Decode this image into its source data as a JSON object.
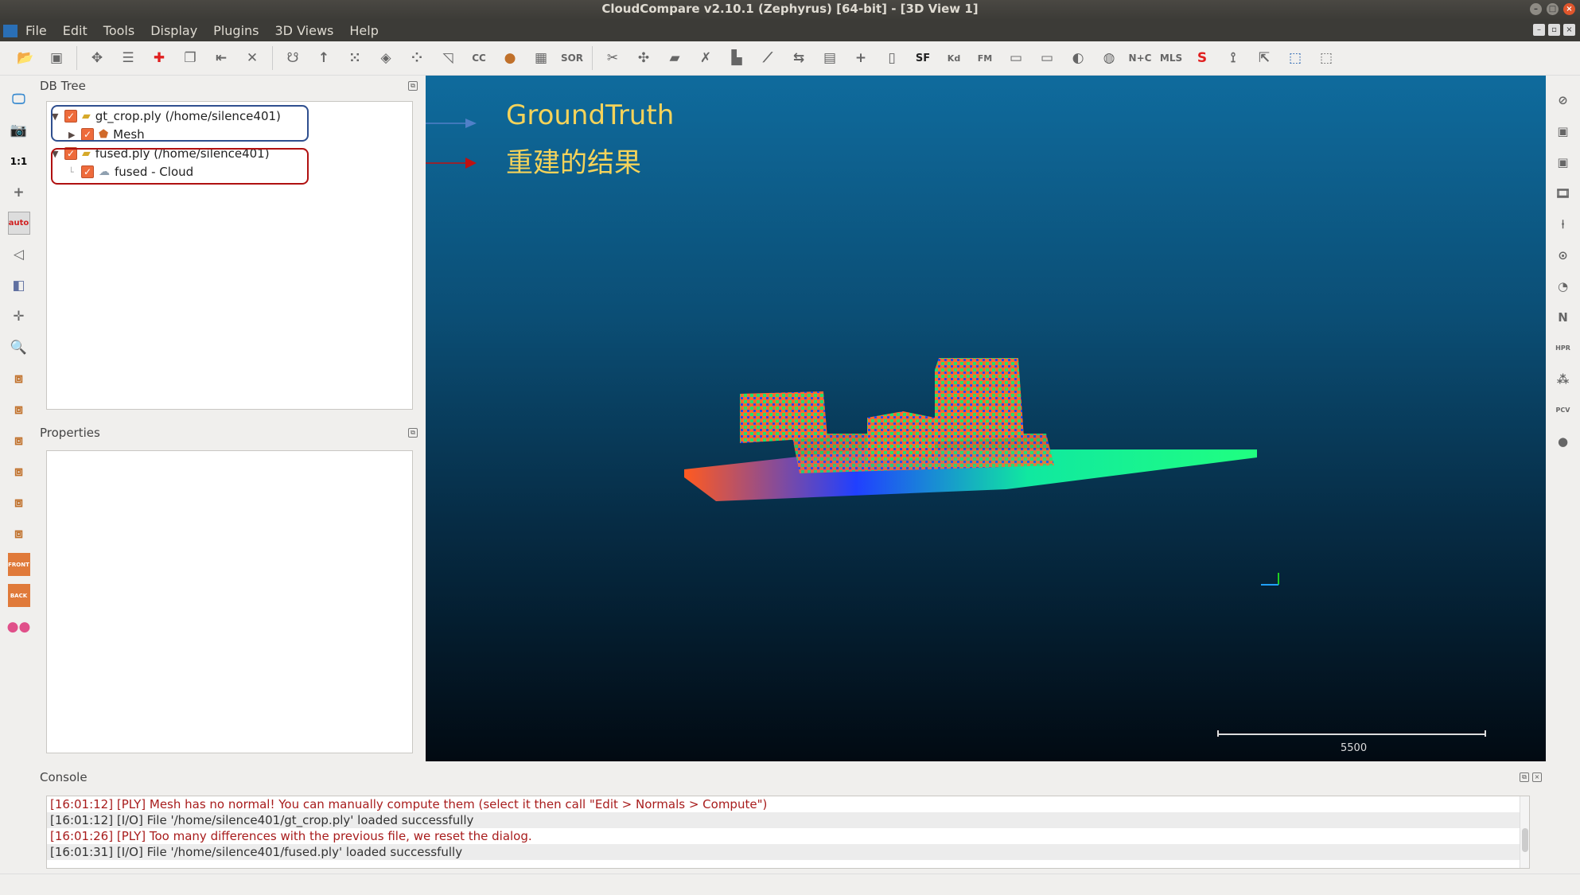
{
  "window": {
    "title": "CloudCompare v2.10.1 (Zephyrus) [64-bit] - [3D View 1]",
    "logo": "CC"
  },
  "menu": [
    "File",
    "Edit",
    "Tools",
    "Display",
    "Plugins",
    "3D Views",
    "Help"
  ],
  "toolbar_icons": [
    "open-icon",
    "save-icon",
    "|",
    "translate-rotate-icon",
    "list-icon",
    "point-pick-icon",
    "clone-icon",
    "merge-icon",
    "delete-icon",
    "|",
    "segment-icon",
    "normals-icon",
    "sample-icon",
    "mesh-icon",
    "subsample-icon",
    "density-icon",
    "cc-icon",
    "primitives-icon",
    "checker-icon",
    "sor-icon",
    "|",
    "scissors-icon",
    "move-icon",
    "plane-icon",
    "cross-icon",
    "histogram-icon",
    "curve-icon",
    "minmax-icon",
    "table-icon",
    "plus-icon",
    "calc-icon",
    "sf-icon",
    "kd-icon",
    "fm-icon",
    "box-icon",
    "box2-icon",
    "sphere-icon",
    "globe-icon",
    "n-c-icon",
    "mls-icon",
    "s-icon",
    "s2-icon",
    "export-icon",
    "canupo-create-icon",
    "canupo-classify-icon"
  ],
  "toolbar_labels": {
    "sor": "SOR",
    "cc": "CC",
    "sf": "SF",
    "kd": "Kd",
    "fm": "FM",
    "nc": "N+C",
    "mls": "MLS"
  },
  "left_toolbar": {
    "one_to_one": "1:1",
    "auto": "auto",
    "front": "FRONT",
    "back": "BACK"
  },
  "db_tree": {
    "title": "DB Tree",
    "items": [
      {
        "label": "gt_crop.ply (/home/silence401)",
        "level": 0,
        "checked": true,
        "icon": "folder-icon"
      },
      {
        "label": "Mesh",
        "level": 1,
        "checked": true,
        "icon": "mesh-icon"
      },
      {
        "label": "fused.ply (/home/silence401)",
        "level": 0,
        "checked": true,
        "icon": "folder-icon"
      },
      {
        "label": "fused - Cloud",
        "level": 1,
        "checked": true,
        "icon": "cloud-icon"
      }
    ]
  },
  "properties": {
    "title": "Properties"
  },
  "view3d": {
    "annotations": [
      "GroundTruth",
      "重建的结果"
    ],
    "scale_label": "5500",
    "background_top": "#0f6b9d",
    "annotation_color": "#f5d35a"
  },
  "right_toolbar": {
    "n": "N",
    "hpr": "HPR",
    "pcv": "PCV"
  },
  "console": {
    "title": "Console",
    "lines": [
      {
        "text": "[16:01:12] [PLY] Mesh has no normal! You can manually compute them (select it then call \"Edit > Normals > Compute\")",
        "level": "error"
      },
      {
        "text": "[16:01:12] [I/O] File '/home/silence401/gt_crop.ply' loaded successfully",
        "level": "info"
      },
      {
        "text": "[16:01:26] [PLY] Too many differences with the previous file, we reset the dialog.",
        "level": "error"
      },
      {
        "text": "[16:01:31] [I/O] File '/home/silence401/fused.ply' loaded successfully",
        "level": "info"
      }
    ]
  }
}
